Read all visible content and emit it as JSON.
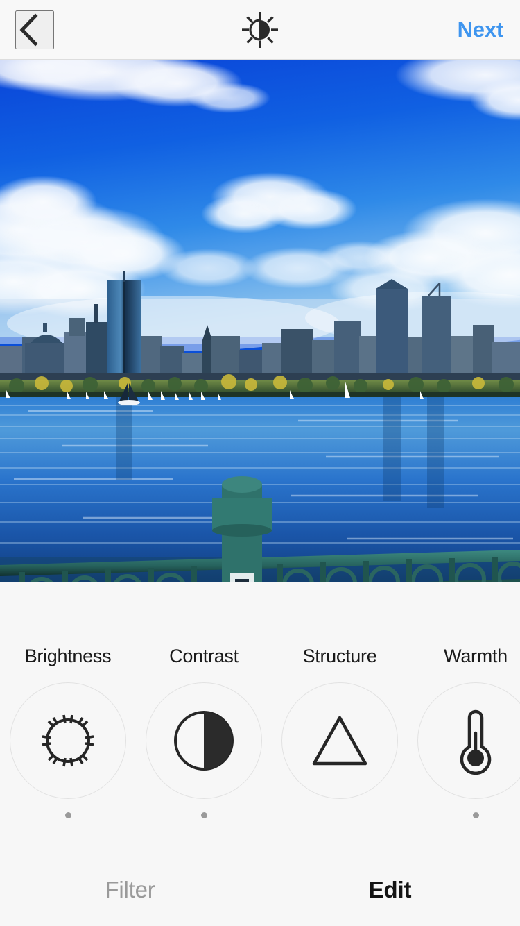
{
  "header": {
    "back_icon": "chevron-left-icon",
    "title_icon": "brightness-sun-half-icon",
    "next_label": "Next",
    "accent_color": "#3e95ef",
    "background_color": "#f8f8f8"
  },
  "photo": {
    "alt": "Boston skyline across the Charles River with sailboats, blue sky and clouds, teal iron railing in foreground",
    "sky_color": "#0b57e0",
    "water_color": "#1f6fd0",
    "railing_color": "#2d6b66"
  },
  "tools": {
    "items": [
      {
        "label": "Brightness",
        "icon": "sun-icon",
        "has_dot": true
      },
      {
        "label": "Contrast",
        "icon": "contrast-half-circle-icon",
        "has_dot": true
      },
      {
        "label": "Structure",
        "icon": "triangle-icon",
        "has_dot": false
      },
      {
        "label": "Warmth",
        "icon": "thermometer-icon",
        "has_dot": true
      }
    ]
  },
  "tabbar": {
    "tabs": [
      {
        "label": "Filter",
        "active": false
      },
      {
        "label": "Edit",
        "active": true
      }
    ],
    "inactive_color": "#9a9a9a",
    "active_color": "#141414"
  }
}
